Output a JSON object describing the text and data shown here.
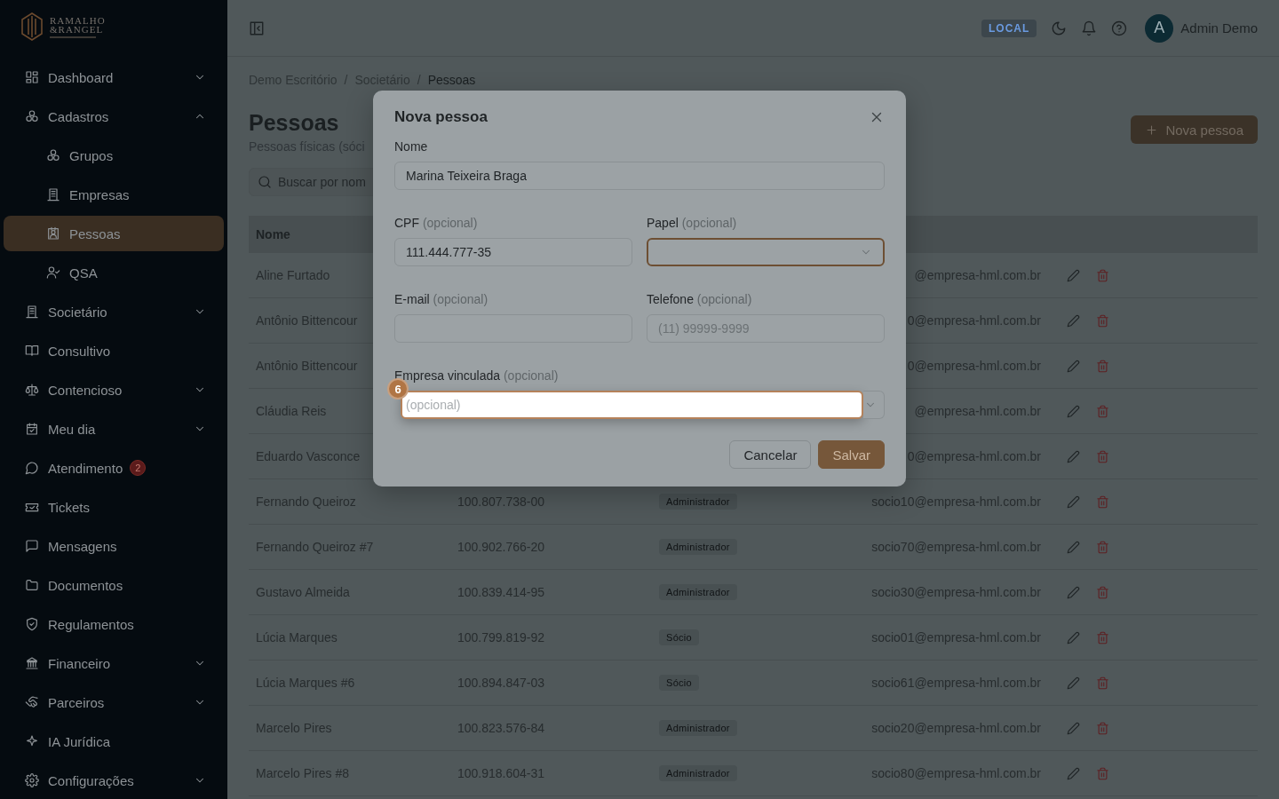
{
  "sidebar": {
    "logo": {
      "line1": "RAMALHO",
      "line2": "&RANGEL"
    },
    "items": [
      {
        "label": "Dashboard",
        "kind": "group",
        "expanded": false,
        "selected": false
      },
      {
        "label": "Cadastros",
        "kind": "group",
        "expanded": true,
        "selected": false,
        "children": [
          {
            "label": "Grupos",
            "selected": false
          },
          {
            "label": "Empresas",
            "selected": false
          },
          {
            "label": "Pessoas",
            "selected": true
          },
          {
            "label": "QSA",
            "selected": false
          }
        ]
      },
      {
        "label": "Societário",
        "kind": "group",
        "expanded": false,
        "selected": false
      },
      {
        "label": "Consultivo",
        "kind": "link",
        "selected": false
      },
      {
        "label": "Contencioso",
        "kind": "group",
        "expanded": false,
        "selected": false
      },
      {
        "label": "Meu dia",
        "kind": "group",
        "expanded": false,
        "selected": false
      },
      {
        "label": "Atendimento",
        "kind": "link",
        "selected": false,
        "badge": "2"
      },
      {
        "label": "Tickets",
        "kind": "link",
        "selected": false
      },
      {
        "label": "Mensagens",
        "kind": "link",
        "selected": false
      },
      {
        "label": "Documentos",
        "kind": "link",
        "selected": false
      },
      {
        "label": "Regulamentos",
        "kind": "link",
        "selected": false
      },
      {
        "label": "Financeiro",
        "kind": "group",
        "expanded": false,
        "selected": false
      },
      {
        "label": "Parceiros",
        "kind": "group",
        "expanded": false,
        "selected": false
      },
      {
        "label": "IA Jurídica",
        "kind": "link",
        "selected": false
      },
      {
        "label": "Configurações",
        "kind": "group",
        "expanded": false,
        "selected": false
      }
    ]
  },
  "topbar": {
    "environment": "LOCAL",
    "user": {
      "initial": "A",
      "name": "Admin Demo"
    }
  },
  "breadcrumb": {
    "separator": "/",
    "items": [
      "Demo Escritório",
      "Societário",
      "Pessoas"
    ]
  },
  "page": {
    "title": "Pessoas",
    "subtitle": "Pessoas físicas (sóci",
    "new_button": "Nova pessoa"
  },
  "search": {
    "placeholder": "Buscar por nom"
  },
  "table": {
    "columns": [
      "Nome"
    ],
    "rows": [
      {
        "name": "Aline Furtado",
        "email": "@empresa-hml.com.br"
      },
      {
        "name": "Antônio Bittencour",
        "email": "0@empresa-hml.com.br"
      },
      {
        "name": "Antônio Bittencour",
        "email": "0@empresa-hml.com.br"
      },
      {
        "name": "Cláudia Reis",
        "email": "@empresa-hml.com.br"
      },
      {
        "name": "Eduardo Vasconce",
        "email": "0@empresa-hml.com.br"
      },
      {
        "name": "Fernando Queiroz",
        "cpf": "100.807.738-00",
        "role": "Administrador",
        "email": "socio10@empresa-hml.com.br"
      },
      {
        "name": "Fernando Queiroz #7",
        "cpf": "100.902.766-20",
        "role": "Administrador",
        "email": "socio70@empresa-hml.com.br"
      },
      {
        "name": "Gustavo Almeida",
        "cpf": "100.839.414-95",
        "role": "Administrador",
        "email": "socio30@empresa-hml.com.br"
      },
      {
        "name": "Lúcia Marques",
        "cpf": "100.799.819-92",
        "role": "Sócio",
        "email": "socio01@empresa-hml.com.br"
      },
      {
        "name": "Lúcia Marques #6",
        "cpf": "100.894.847-03",
        "role": "Sócio",
        "email": "socio61@empresa-hml.com.br"
      },
      {
        "name": "Marcelo Pires",
        "cpf": "100.823.576-84",
        "role": "Administrador",
        "email": "socio20@empresa-hml.com.br"
      },
      {
        "name": "Marcelo Pires #8",
        "cpf": "100.918.604-31",
        "role": "Administrador",
        "email": "socio80@empresa-hml.com.br"
      }
    ]
  },
  "dialog": {
    "title": "Nova pessoa",
    "fields": [
      {
        "label": "Nome",
        "kind": "text",
        "value": "Marina Teixeira Braga",
        "focused": false,
        "highlighted": false
      },
      {
        "label": "CPF",
        "hint": "(opcional)",
        "kind": "text",
        "value": "111.444.777-35",
        "focused": false,
        "highlighted": false
      },
      {
        "label": "Papel",
        "hint": "(opcional)",
        "kind": "select",
        "focused": true,
        "highlighted": false
      },
      {
        "label": "E-mail",
        "hint": "(opcional)",
        "kind": "text",
        "focused": false,
        "highlighted": false
      },
      {
        "label": "Telefone",
        "hint": "(opcional)",
        "kind": "text",
        "placeholder": "(11) 99999-9999",
        "focused": false,
        "highlighted": false
      },
      {
        "label": "Empresa vinculada",
        "hint": "(opcional)",
        "kind": "select",
        "placeholder": "(opcional)",
        "focused": false,
        "highlighted": true
      }
    ],
    "buttons": [
      {
        "label": "Cancelar",
        "kind": "secondary"
      },
      {
        "label": "Salvar",
        "kind": "primary"
      }
    ],
    "tour_step": "6"
  }
}
